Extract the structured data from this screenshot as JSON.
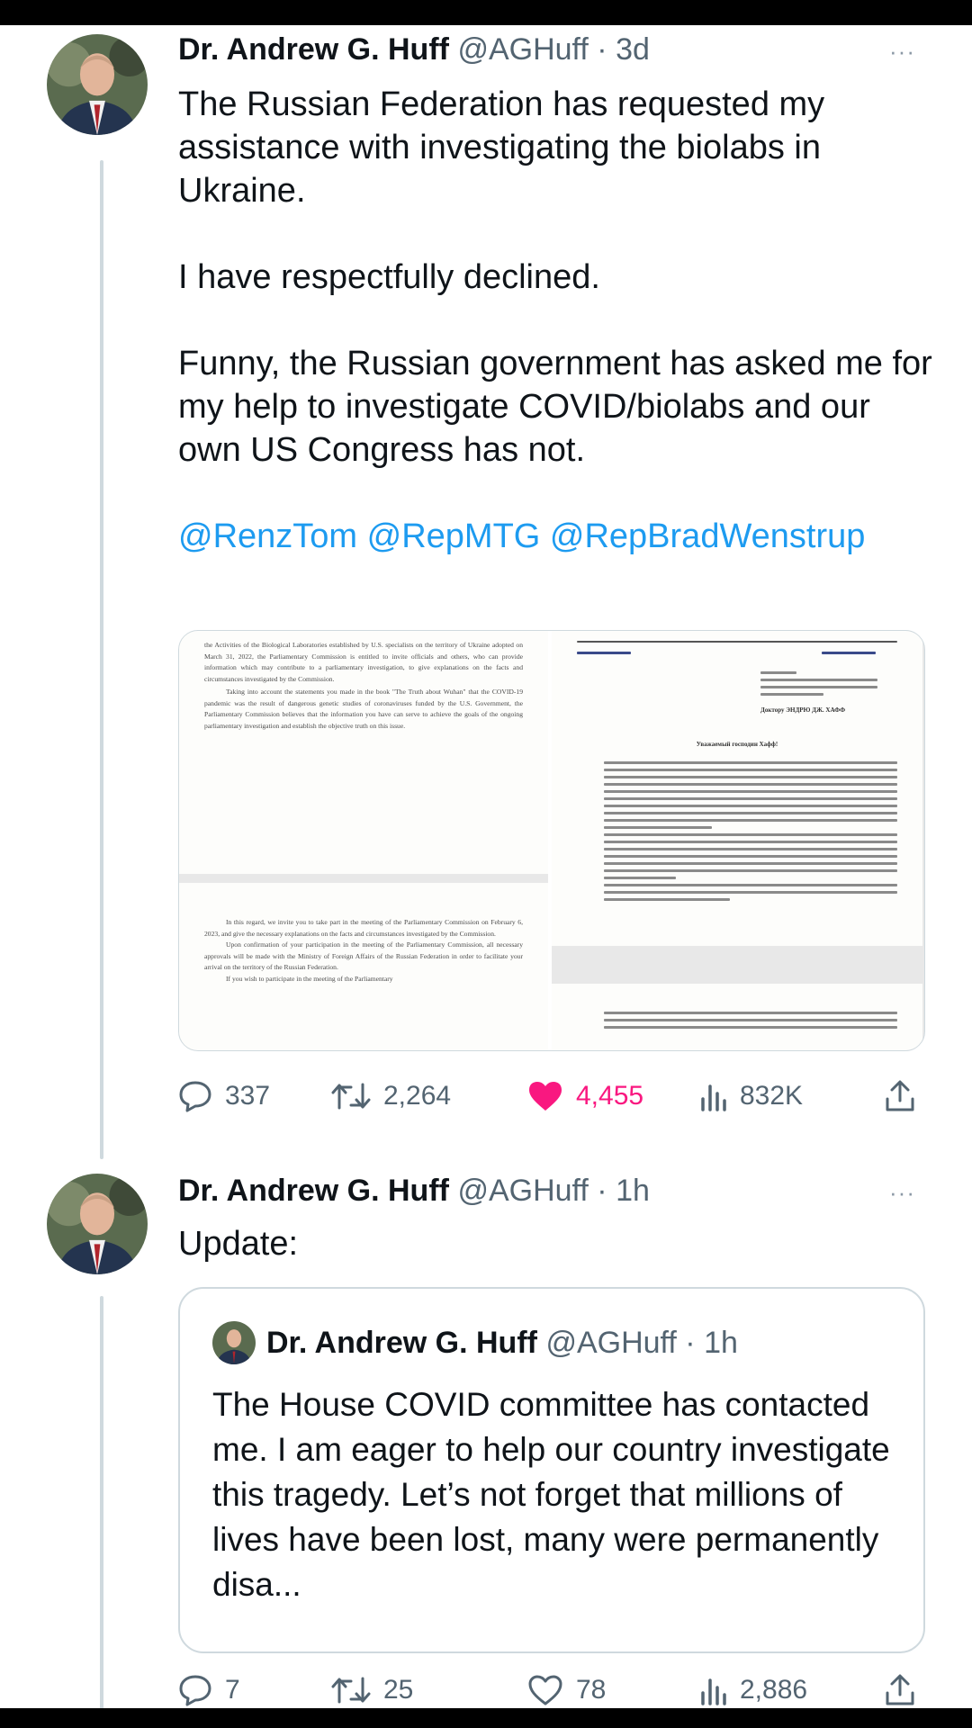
{
  "tweet1": {
    "name": "Dr. Andrew G. Huff",
    "handle": "@AGHuff",
    "time": "3d",
    "separator": "·",
    "more": "···",
    "paragraphs": [
      "The Russian Federation has requested my assistance with investigating the biolabs in Ukraine.",
      "I have respectfully declined.",
      "Funny, the Russian government has asked me for my help to investigate COVID/biolabs and our own US Congress has not."
    ],
    "mentions": "@RenzTom @RepMTG @RepBradWenstrup",
    "media": {
      "doc_en_1": "the Activities of the Biological Laboratories established by U.S. specialists on the territory of Ukraine adopted on March 31, 2022, the Parliamentary Commission is entitled to invite officials and others, who can provide information which may contribute to a parliamentary investigation, to give explanations on the facts and circumstances investigated by the Commission.",
      "doc_en_2": "Taking into account the statements you made in the book \"The Truth about Wuhan\" that the COVID-19 pandemic was the result of dangerous genetic studies of coronaviruses funded by the U.S. Government, the Parliamentary Commission believes that the information you have can serve to achieve the goals of the ongoing parliamentary investigation and establish the objective truth on this issue.",
      "doc_en_3": "In this regard, we invite you to take part in the meeting of the Parliamentary Commission on February 6, 2023, and give the necessary explanations on the facts and circumstances investigated by the Commission.",
      "doc_en_4": "Upon confirmation of your participation in the meeting of the Parliamentary Commission, all necessary approvals will be made with the Ministry of Foreign Affairs of the Russian Federation in order to facilitate your arrival on the territory of the Russian Federation.",
      "doc_en_5": "If you wish to participate in the meeting of the Parliamentary",
      "doc_ru_addressee": "Доктору ЭНДРЮ ДЖ. ХАФФ",
      "doc_ru_salutation": "Уважаемый господин Хафф!"
    },
    "stats": {
      "replies": "337",
      "retweets": "2,264",
      "likes": "4,455",
      "views": "832K"
    }
  },
  "tweet2": {
    "name": "Dr. Andrew G. Huff",
    "handle": "@AGHuff",
    "time": "1h",
    "separator": "·",
    "more": "···",
    "text": "Update:",
    "quote": {
      "name": "Dr. Andrew G. Huff",
      "handle": "@AGHuff",
      "time": "1h",
      "separator": "·",
      "text": "The House COVID committee has contacted me. I am eager to help our country investigate this tragedy. Let’s not forget that millions of lives have been lost, many were permanently disa..."
    },
    "stats": {
      "replies": "7",
      "retweets": "25",
      "likes": "78",
      "views": "2,886"
    }
  },
  "colors": {
    "accent": "#1d9bf0",
    "like": "#f91880",
    "muted": "#536471",
    "border": "#cfd9de"
  }
}
